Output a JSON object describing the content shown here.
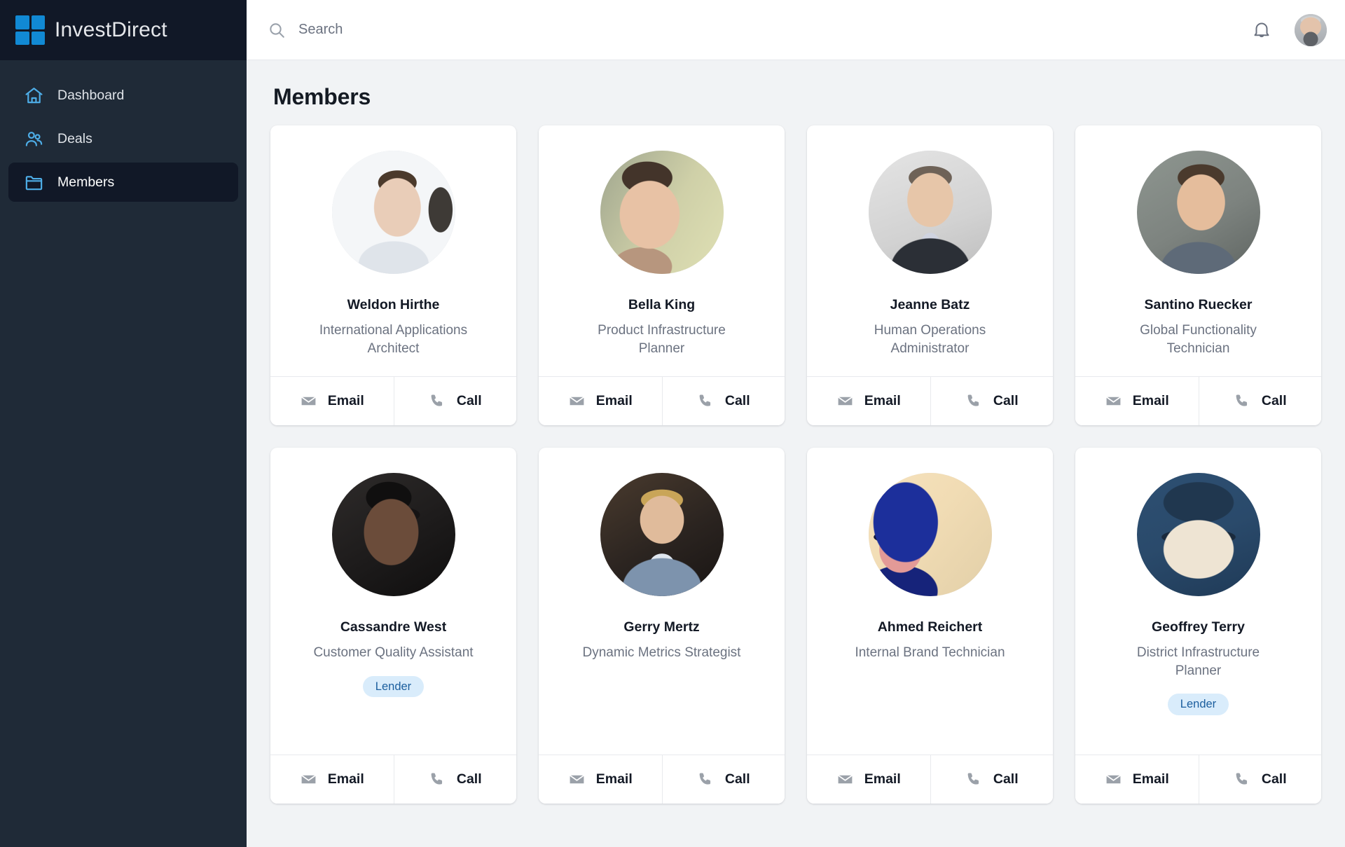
{
  "brand": {
    "name": "InvestDirect",
    "logo_icon": "four-squares-logo",
    "accent": "#1189d4"
  },
  "sidebar": {
    "items": [
      {
        "label": "Dashboard",
        "icon": "home-icon",
        "active": false
      },
      {
        "label": "Deals",
        "icon": "users-icon",
        "active": false
      },
      {
        "label": "Members",
        "icon": "folder-icon",
        "active": true
      }
    ]
  },
  "topbar": {
    "search": {
      "placeholder": "Search",
      "value": "",
      "icon": "search-icon"
    },
    "notifications_icon": "bell-icon",
    "avatar": "user-avatar"
  },
  "page": {
    "title": "Members"
  },
  "card_actions": {
    "email_label": "Email",
    "email_icon": "envelope-icon",
    "call_label": "Call",
    "call_icon": "phone-icon"
  },
  "members": [
    {
      "name": "Weldon Hirthe",
      "role": "International Applications Architect",
      "badge": ""
    },
    {
      "name": "Bella King",
      "role": "Product Infrastructure Planner",
      "badge": ""
    },
    {
      "name": "Jeanne Batz",
      "role": "Human Operations Administrator",
      "badge": ""
    },
    {
      "name": "Santino Ruecker",
      "role": "Global Functionality Technician",
      "badge": ""
    },
    {
      "name": "Cassandre West",
      "role": "Customer Quality Assistant",
      "badge": "Lender"
    },
    {
      "name": "Gerry Mertz",
      "role": "Dynamic Metrics Strategist",
      "badge": ""
    },
    {
      "name": "Ahmed Reichert",
      "role": "Internal Brand Technician",
      "badge": ""
    },
    {
      "name": "Geoffrey Terry",
      "role": "District Infrastructure Planner",
      "badge": "Lender"
    }
  ],
  "colors": {
    "sidebar_bg": "#1f2a37",
    "sidebar_brand_bg": "#111827",
    "page_bg": "#f1f3f5",
    "card_bg": "#ffffff",
    "badge_bg": "#d9ecfb",
    "badge_text": "#1b5e9e",
    "muted_text": "#6b7280"
  }
}
